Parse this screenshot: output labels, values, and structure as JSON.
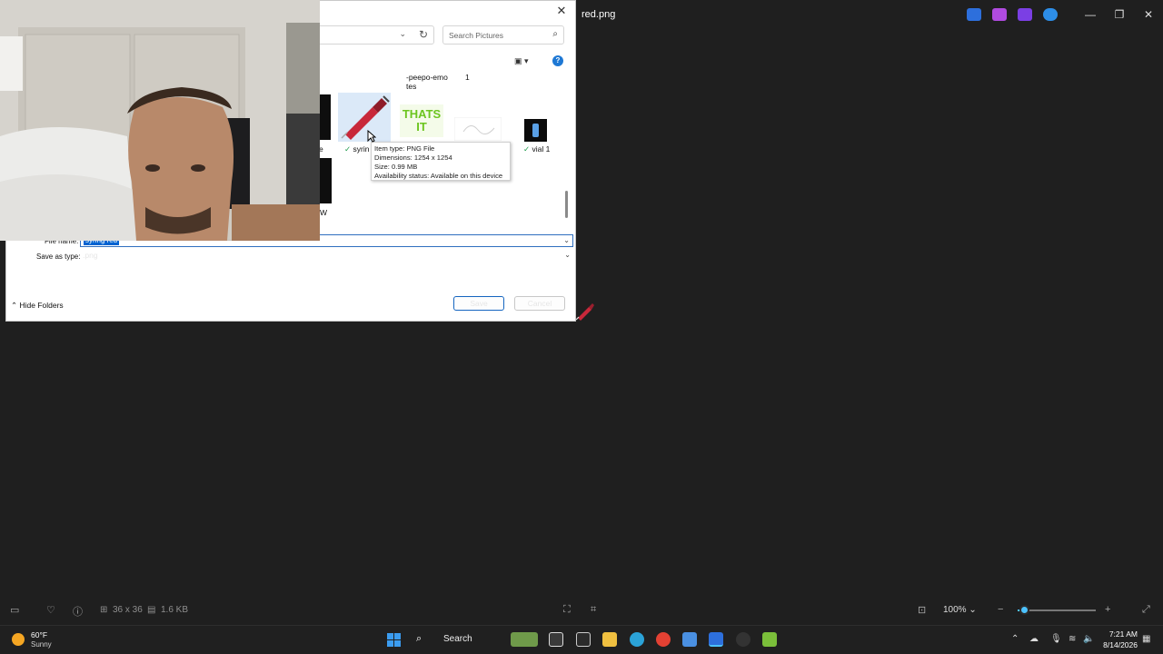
{
  "viewer": {
    "title": "red.png",
    "status_dims": "36 x 36",
    "status_size": "1.6 KB",
    "zoom_label": "100%"
  },
  "dialog": {
    "search_placeholder": "Search Pictures",
    "files": [
      {
        "label_line1": "-peepo-emo",
        "label_line2": "tes"
      },
      {
        "label_line1": "1"
      },
      {
        "label_line1": "syrin"
      },
      {
        "label_line1": "vial 1"
      },
      {
        "label_line1": "e"
      },
      {
        "label_line1": "W"
      }
    ],
    "tooltip": {
      "type": "Item type: PNG File",
      "dimensions": "Dimensions: 1254 x 1254",
      "size": "Size: 0.99 MB",
      "availability": "Availability status: Available on this device"
    },
    "filename_label": "File name:",
    "filename_value": "syring red",
    "savetype_label": "Save as type:",
    "savetype_value": ".png",
    "hide_folders": "Hide Folders",
    "save_label": "Save",
    "cancel_label": "Cancel",
    "thumb_text": "THATS IT"
  },
  "taskbar": {
    "weather_temp": "60°F",
    "weather_desc": "Sunny",
    "search_label": "Search",
    "time": "7:21 AM",
    "date": "8/14/2026"
  },
  "colors": {
    "accent": "#0063d1",
    "zoom_accent": "#4cc2ff",
    "background": "#1f1f1f"
  }
}
